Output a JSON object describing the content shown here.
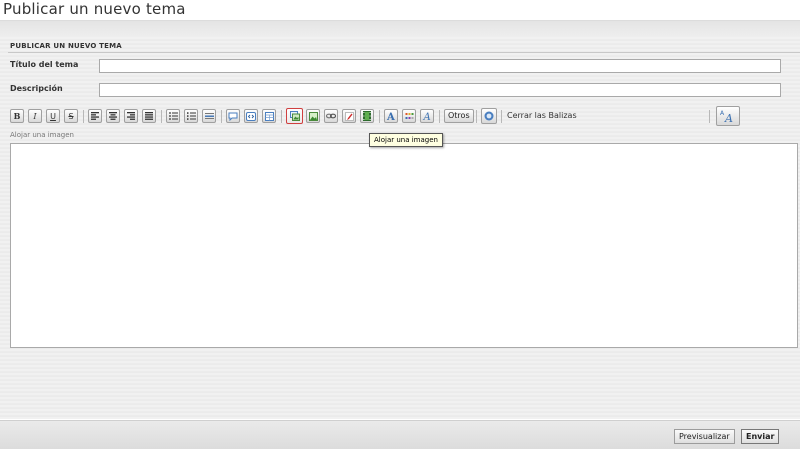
{
  "page": {
    "title": "Publicar un nuevo tema"
  },
  "form": {
    "section_title": "PUBLICAR UN NUEVO TEMA",
    "title_label": "Título del tema",
    "title_value": "",
    "description_label": "Descripción",
    "description_value": "",
    "status_hint": "Alojar una imagen",
    "body_value": ""
  },
  "toolbar": {
    "bold": "B",
    "italic": "I",
    "underline": "U",
    "strike": "S",
    "others_label": "Otros",
    "close_tags_label": "Cerrar las Balizas",
    "font_size_glyph": "A"
  },
  "tooltip": {
    "text": "Alojar una imagen"
  },
  "footer": {
    "preview_label": "Previsualizar",
    "submit_label": "Enviar"
  },
  "colors": {
    "active_button_border": "#d04040",
    "tooltip_background": "#ffffe1"
  }
}
